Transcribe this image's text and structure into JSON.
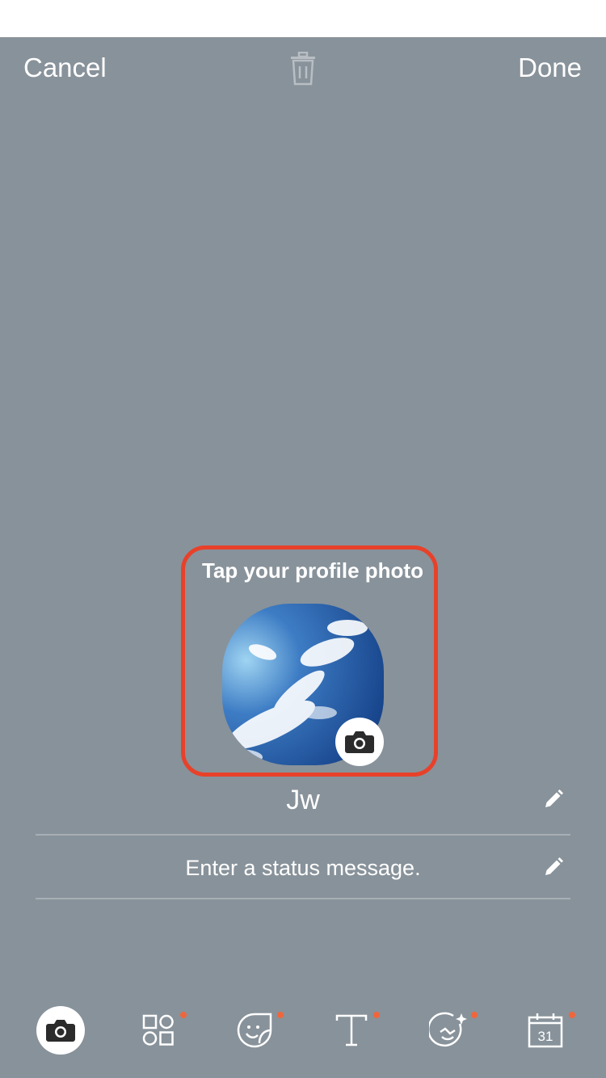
{
  "header": {
    "cancel_label": "Cancel",
    "done_label": "Done",
    "delete_icon": "trash-icon"
  },
  "profile": {
    "hint": "Tap your profile photo",
    "photo_description_icon": "sky-photo",
    "camera_icon": "camera-icon",
    "name": "Jw",
    "status_placeholder": "Enter a status message."
  },
  "toolbar": {
    "items": [
      {
        "icon": "camera-icon",
        "active": true,
        "new_dot": false
      },
      {
        "icon": "shapes-icon",
        "active": false,
        "new_dot": true
      },
      {
        "icon": "sticker-icon",
        "active": false,
        "new_dot": true
      },
      {
        "icon": "text-icon",
        "active": false,
        "new_dot": true
      },
      {
        "icon": "effect-icon",
        "active": false,
        "new_dot": true
      },
      {
        "icon": "calendar-icon",
        "calendar_day": "31",
        "active": false,
        "new_dot": true
      }
    ]
  },
  "colors": {
    "background": "#88929a",
    "highlight": "#e8412a",
    "new_dot": "#f0663c"
  }
}
